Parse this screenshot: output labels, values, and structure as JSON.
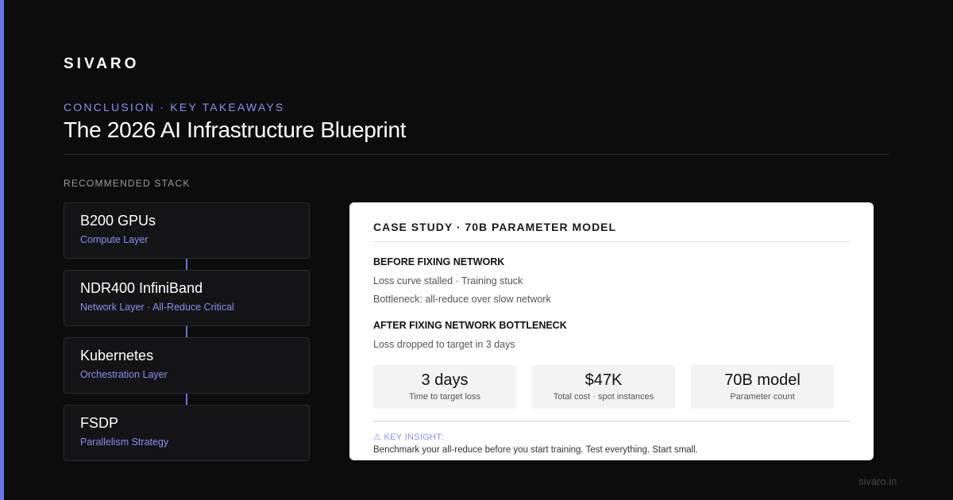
{
  "brand": "SIVARO",
  "eyebrow": "CONCLUSION · KEY TAKEAWAYS",
  "title": "The 2026 AI Infrastructure Blueprint",
  "stack": {
    "heading": "RECOMMENDED STACK",
    "items": [
      {
        "name": "B200 GPUs",
        "sub": "Compute Layer"
      },
      {
        "name": "NDR400 InfiniBand",
        "sub": "Network Layer · All-Reduce Critical"
      },
      {
        "name": "Kubernetes",
        "sub": "Orchestration Layer"
      },
      {
        "name": "FSDP",
        "sub": "Parallelism Strategy"
      }
    ]
  },
  "case_study": {
    "title": "CASE STUDY · 70B PARAMETER MODEL",
    "before": {
      "label": "BEFORE FIXING NETWORK",
      "lines": [
        "Loss curve stalled · Training stuck",
        "Bottleneck: all-reduce over slow network"
      ]
    },
    "after": {
      "label": "AFTER FIXING NETWORK BOTTLENECK",
      "lines": [
        "Loss dropped to target in 3 days"
      ]
    },
    "metrics": [
      {
        "value": "3 days",
        "label": "Time to target loss"
      },
      {
        "value": "$47K",
        "label": "Total cost · spot instances"
      },
      {
        "value": "70B model",
        "label": "Parameter count"
      }
    ],
    "insight": {
      "label": "⚠ KEY INSIGHT:",
      "text": "Benchmark your all-reduce before you start training. Test everything. Start small."
    }
  },
  "footer": {
    "url": "sivaro.in"
  },
  "colors": {
    "accent": "#6a72e8",
    "accent_text": "#8a8ff0",
    "background": "#0c0c0d",
    "card": "#ffffff"
  }
}
